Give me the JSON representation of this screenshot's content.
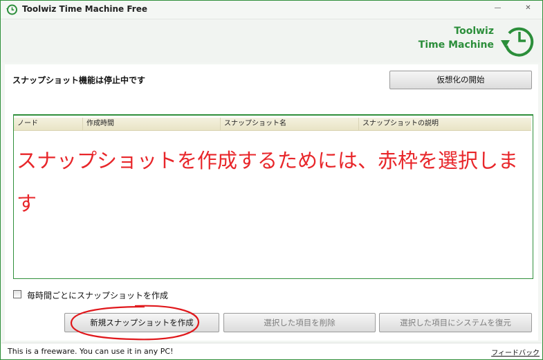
{
  "window": {
    "title": "Toolwiz Time Machine Free",
    "minimize_label": "—",
    "close_label": "✕"
  },
  "brand": {
    "line1": "Toolwiz",
    "line2": "Time Machine",
    "color": "#2b8e3a"
  },
  "status_text": "スナップショット機能は停止中です",
  "buttons": {
    "virtualize": "仮想化の開始",
    "new_snapshot": "新規スナップショットを作成",
    "delete_selected": "選択した項目を削除",
    "restore_selected": "選択した項目にシステムを復元"
  },
  "table": {
    "columns": [
      "ノード",
      "作成時間",
      "スナップショット名",
      "スナップショットの説明"
    ],
    "rows": []
  },
  "annotation": {
    "text": "スナップショットを作成するためには、赤枠を選択します",
    "color": "#e8262a"
  },
  "hourly_checkbox": {
    "label": "毎時間ごとにスナップショットを作成",
    "checked": false
  },
  "footer": {
    "text": "This is a freeware. You can use it in any PC!",
    "feedback": "フィードバック"
  }
}
